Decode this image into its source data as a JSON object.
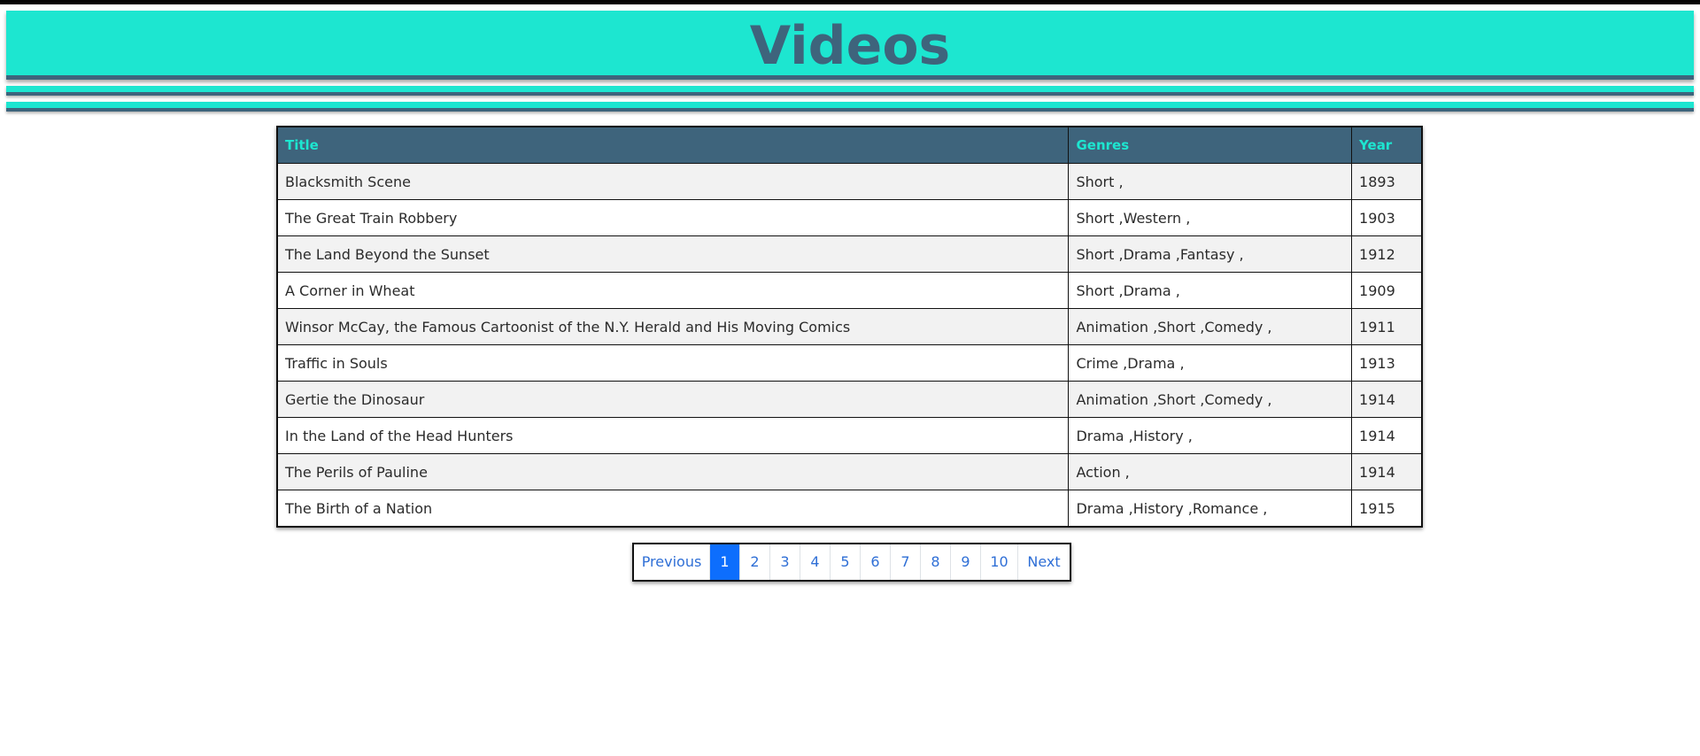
{
  "header": {
    "title": "Videos"
  },
  "table": {
    "columns": [
      "Title",
      "Genres",
      "Year"
    ],
    "rows": [
      {
        "title": "Blacksmith Scene",
        "genres": "Short ,",
        "year": "1893"
      },
      {
        "title": "The Great Train Robbery",
        "genres": "Short ,Western ,",
        "year": "1903"
      },
      {
        "title": "The Land Beyond the Sunset",
        "genres": "Short ,Drama ,Fantasy ,",
        "year": "1912"
      },
      {
        "title": "A Corner in Wheat",
        "genres": "Short ,Drama ,",
        "year": "1909"
      },
      {
        "title": "Winsor McCay, the Famous Cartoonist of the N.Y. Herald and His Moving Comics",
        "genres": "Animation ,Short ,Comedy ,",
        "year": "1911"
      },
      {
        "title": "Traffic in Souls",
        "genres": "Crime ,Drama ,",
        "year": "1913"
      },
      {
        "title": "Gertie the Dinosaur",
        "genres": "Animation ,Short ,Comedy ,",
        "year": "1914"
      },
      {
        "title": "In the Land of the Head Hunters",
        "genres": "Drama ,History ,",
        "year": "1914"
      },
      {
        "title": "The Perils of Pauline",
        "genres": "Action ,",
        "year": "1914"
      },
      {
        "title": "The Birth of a Nation",
        "genres": "Drama ,History ,Romance ,",
        "year": "1915"
      }
    ]
  },
  "pagination": {
    "previous_label": "Previous",
    "next_label": "Next",
    "pages": [
      "1",
      "2",
      "3",
      "4",
      "5",
      "6",
      "7",
      "8",
      "9",
      "10"
    ],
    "active_page": "1"
  },
  "colors": {
    "accent": "#1de6d0",
    "dark": "#3e647c",
    "active_page": "#0d6efd",
    "link": "#2f6fd6"
  }
}
